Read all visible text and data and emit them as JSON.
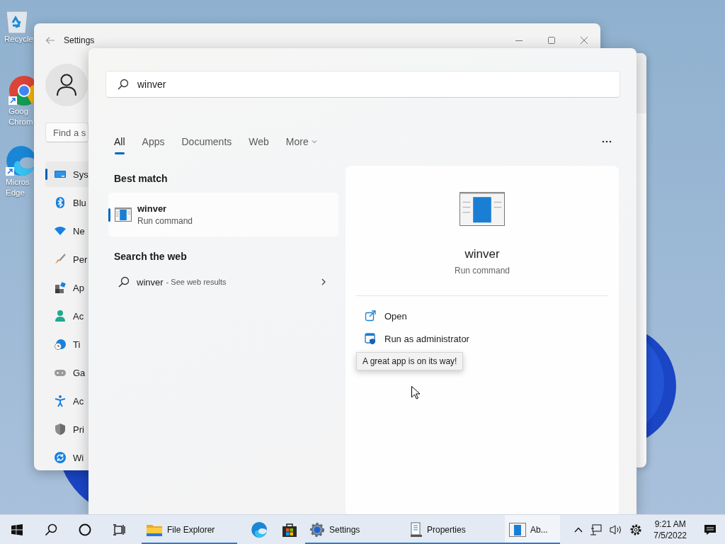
{
  "desktop": {
    "icons": [
      {
        "kind": "recycle",
        "lines": [
          "Recycle"
        ]
      },
      {
        "kind": "chrome",
        "lines": [
          "Goog",
          "Chrom"
        ]
      },
      {
        "kind": "edge",
        "lines": [
          "Micros",
          "Edge"
        ]
      }
    ]
  },
  "settings_window": {
    "title": "Settings",
    "search": {
      "placeholder": "Find a s"
    },
    "nav": [
      {
        "kind": "system",
        "label": "Sys",
        "selected": true
      },
      {
        "kind": "bluetooth",
        "label": "Blu",
        "selected": false
      },
      {
        "kind": "network",
        "label": "Ne",
        "selected": false
      },
      {
        "kind": "personalization",
        "label": "Per",
        "selected": false
      },
      {
        "kind": "apps",
        "label": "Ap",
        "selected": false
      },
      {
        "kind": "accounts",
        "label": "Ac",
        "selected": false
      },
      {
        "kind": "time",
        "label": "Ti",
        "selected": false
      },
      {
        "kind": "gaming",
        "label": "Ga",
        "selected": false
      },
      {
        "kind": "accessibility",
        "label": "Ac",
        "selected": false
      },
      {
        "kind": "privacy",
        "label": "Pri",
        "selected": false
      },
      {
        "kind": "update",
        "label": "Wi",
        "selected": false
      }
    ]
  },
  "search_panel": {
    "query": "winver",
    "tabs": [
      {
        "label": "All",
        "selected": true,
        "has_menu": false
      },
      {
        "label": "Apps",
        "selected": false,
        "has_menu": false
      },
      {
        "label": "Documents",
        "selected": false,
        "has_menu": false
      },
      {
        "label": "Web",
        "selected": false,
        "has_menu": false
      },
      {
        "label": "More",
        "selected": false,
        "has_menu": true
      }
    ],
    "best_match": {
      "heading": "Best match",
      "title": "winver",
      "subtitle": "Run command",
      "selected": true
    },
    "web": {
      "heading": "Search the web",
      "query": "winver",
      "hint": "- See web results"
    },
    "details": {
      "title": "winver",
      "subtitle": "Run command",
      "actions": [
        {
          "kind": "open",
          "label": "Open"
        },
        {
          "kind": "admin",
          "label": "Run as administrator"
        }
      ]
    },
    "tooltip": "A great app is on its way!"
  },
  "taskbar": {
    "items": [
      {
        "kind": "start",
        "running": false,
        "active": false
      },
      {
        "kind": "search",
        "running": false,
        "active": false
      },
      {
        "kind": "cortana",
        "running": false,
        "active": false
      },
      {
        "kind": "taskview",
        "running": false,
        "active": false
      },
      {
        "kind": "explorer",
        "label": "File Explorer",
        "running": true,
        "active": false
      },
      {
        "kind": "edge",
        "running": false,
        "active": false
      },
      {
        "kind": "store",
        "running": false,
        "active": false
      },
      {
        "kind": "settings",
        "label": "Settings",
        "running": true,
        "active": false
      },
      {
        "kind": "properties",
        "label": "Properties",
        "running": true,
        "active": false
      },
      {
        "kind": "winver",
        "label": "Ab...",
        "running": true,
        "active": true
      }
    ],
    "tray": {
      "time": "9:21 AM",
      "date": "7/5/2022"
    }
  }
}
